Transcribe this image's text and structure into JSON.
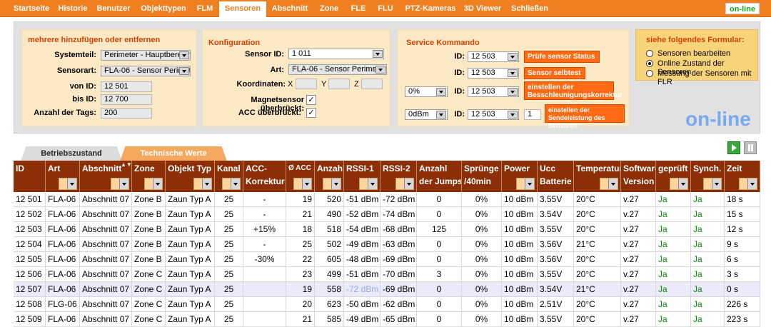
{
  "nav": {
    "items": [
      "Startseite",
      "Historie",
      "Benutzer",
      "Objekttypen",
      "FLM",
      "Sensoren",
      "Abschnitt",
      "Zone",
      "FLE",
      "FLU",
      "PTZ-Kameras",
      "3D Viewer",
      "Schließen"
    ],
    "active": "Sensoren",
    "status": "on-line"
  },
  "box1": {
    "title": "mehrere hinzufügen oder entfernen",
    "systemteil_label": "Systemteil:",
    "systemteil_value": "Perimeter - Hauptbereich",
    "sensorart_label": "Sensorart:",
    "sensorart_value": "FLA-06 - Sensor Perimeter",
    "vonid_label": "von ID:",
    "vonid_value": "12 501",
    "bisid_label": "bis ID:",
    "bisid_value": "12 700",
    "tags_label": "Anzahl der Tags:",
    "tags_value": "200"
  },
  "box2": {
    "title": "Konfiguration",
    "sensorid_label": "Sensor ID:",
    "sensorid_value": "1 011",
    "art_label": "Art:",
    "art_value": "FLA-06 - Sensor Perimeter",
    "koord_label": "Koordinaten:",
    "x_label": "X",
    "y_label": "Y",
    "z_label": "Z",
    "magnet_label": "Magnetsensor überbrückt:",
    "acc_label": "ACC überbrückt:",
    "check_mark": "✓"
  },
  "box3": {
    "title": "Service Kommando",
    "id_label": "ID:",
    "r1_id": "12 503",
    "r1_btn": "Prüfe sensor Status",
    "r2_id": "12 503",
    "r2_btn": "Sensor selbtest",
    "r3_pct": "0%",
    "r3_id": "12 503",
    "r3_btn": "einstellen der Besschleunigungskorrektur",
    "r4_dbm": "0dBm",
    "r4_id": "12 503",
    "r4_n": "1",
    "r4_btn": "einstellen der Sendeleistung des Sensoren"
  },
  "box4": {
    "title": "siehe folgendes Formular:",
    "options": [
      "Sensoren bearbeiten",
      "Online Zustand der Sensoren",
      "Messung der Sensoren mit FLR"
    ],
    "selected": 1
  },
  "online_big": "on-line",
  "tabs": {
    "b": "Betriebszustand",
    "t": "Technische Werte"
  },
  "columns": [
    {
      "l1": "ID",
      "l2": "",
      "f": false
    },
    {
      "l1": "Art",
      "l2": "",
      "f": true
    },
    {
      "l1": "Abschnitt",
      "l2": "",
      "f": true,
      "sort": "▲▼"
    },
    {
      "l1": "Zone",
      "l2": "",
      "f": true
    },
    {
      "l1": "Objekt Typ",
      "l2": "",
      "f": true
    },
    {
      "l1": "Kanal",
      "l2": "",
      "f": true
    },
    {
      "l1": "ACC-",
      "l2": "Korrektur",
      "f": false
    },
    {
      "l1": "Ø ACC",
      "l2": "",
      "f": true,
      "small": true
    },
    {
      "l1": "Anzahl",
      "l2": "",
      "f": true
    },
    {
      "l1": "RSSI-1",
      "l2": "",
      "f": true
    },
    {
      "l1": "RSSI-2",
      "l2": "",
      "f": true
    },
    {
      "l1": "Anzahl",
      "l2": "der Jumps",
      "f": false
    },
    {
      "l1": "Sprünge",
      "l2": "/40min",
      "f": false
    },
    {
      "l1": "Power",
      "l2": "",
      "f": true
    },
    {
      "l1": "Ucc",
      "l2": "Batterie",
      "f": false
    },
    {
      "l1": "Temperatur",
      "l2": "",
      "f": true
    },
    {
      "l1": "Software",
      "l2": "Version",
      "f": false
    },
    {
      "l1": "geprüft",
      "l2": "",
      "f": true
    },
    {
      "l1": "Synch.",
      "l2": "",
      "f": true
    },
    {
      "l1": "Zeit",
      "l2": "",
      "f": true
    }
  ],
  "rows": [
    [
      "12 501",
      "FLA-06",
      "Abschnitt 07",
      "Zone B",
      "Zaun Typ A",
      "25",
      "-",
      "19",
      "520",
      "-51 dBm",
      "-72 dBm",
      "0",
      "0%",
      "10 dBm",
      "3.55V",
      "20°C",
      "v.27",
      "Ja",
      "Ja",
      "18 s"
    ],
    [
      "12 502",
      "FLA-06",
      "Abschnitt 07",
      "Zone B",
      "Zaun Typ A",
      "25",
      "-",
      "21",
      "490",
      "-52 dBm",
      "-74 dBm",
      "0",
      "0%",
      "10 dBm",
      "3.54V",
      "20°C",
      "v.27",
      "Ja",
      "Ja",
      "15 s"
    ],
    [
      "12 503",
      "FLA-06",
      "Abschnitt 07",
      "Zone B",
      "Zaun Typ A",
      "25",
      "+15%",
      "18",
      "518",
      "-54 dBm",
      "-68 dBm",
      "125",
      "0%",
      "10 dBm",
      "3.55V",
      "20°C",
      "v.27",
      "Ja",
      "Ja",
      "12 s"
    ],
    [
      "12 504",
      "FLA-06",
      "Abschnitt 07",
      "Zone B",
      "Zaun Typ A",
      "25",
      "-",
      "25",
      "502",
      "-49 dBm",
      "-63 dBm",
      "0",
      "0%",
      "10 dBm",
      "3.56V",
      "21°C",
      "v.27",
      "Ja",
      "Ja",
      "9 s"
    ],
    [
      "12 505",
      "FLA-06",
      "Abschnitt 07",
      "Zone B",
      "Zaun Typ A",
      "25",
      "-30%",
      "22",
      "605",
      "-48 dBm",
      "-69 dBm",
      "0",
      "0%",
      "10 dBm",
      "3.56V",
      "20°C",
      "v.27",
      "Ja",
      "Ja",
      "6 s"
    ],
    [
      "12 506",
      "FLA-06",
      "Abschnitt 07",
      "Zone C",
      "Zaun Typ A",
      "25",
      "",
      "23",
      "499",
      "-51 dBm",
      "-70 dBm",
      "3",
      "0%",
      "10 dBm",
      "3.55V",
      "20°C",
      "v.27",
      "Ja",
      "Ja",
      "3 s"
    ],
    [
      "12 507",
      "FLA-06",
      "Abschnitt 07",
      "Zone C",
      "Zaun Typ A",
      "25",
      "",
      "19",
      "558",
      "-72 dBm",
      "-69 dBm",
      "0",
      "0%",
      "10 dBm",
      "3.54V",
      "21°C",
      "v.27",
      "Ja",
      "Ja",
      "0 s"
    ],
    [
      "12 508",
      "FLG-06",
      "Abschnitt 07",
      "Zone C",
      "Zaun Typ A",
      "25",
      "",
      "20",
      "623",
      "-50 dBm",
      "-62 dBm",
      "0",
      "0%",
      "10 dBm",
      "2.51V",
      "20°C",
      "v.27",
      "Ja",
      "Ja",
      "226 s"
    ],
    [
      "12 509",
      "FLA-06",
      "Abschnitt 07",
      "Zone C",
      "Zaun Typ A",
      "25",
      "",
      "21",
      "585",
      "-49 dBm",
      "-65 dBm",
      "0",
      "0%",
      "10 dBm",
      "3.55V",
      "20°C",
      "v.27",
      "Ja",
      "Ja",
      "223 s"
    ]
  ],
  "highlight_row": 6,
  "dim_cell": {
    "row": 6,
    "col": 9
  }
}
